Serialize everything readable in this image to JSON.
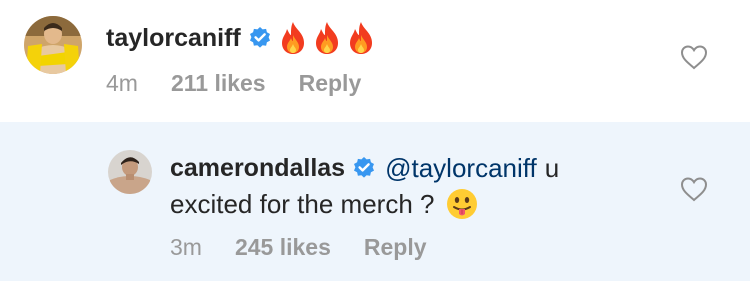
{
  "comments": [
    {
      "username": "taylorcaniff",
      "verified": true,
      "text_emoji": [
        "fire-emoji",
        "fire-emoji",
        "fire-emoji"
      ],
      "time": "4m",
      "likes": "211 likes",
      "reply_label": "Reply",
      "avatar_icon": "avatar-photo"
    },
    {
      "username": "camerondallas",
      "verified": true,
      "mention": "@taylorcaniff",
      "text_line1": "u",
      "text_line2": "excited for the merch ?",
      "text_emoji": "tongue-out-emoji",
      "time": "3m",
      "likes": "245 likes",
      "reply_label": "Reply",
      "avatar_icon": "avatar-photo"
    }
  ],
  "colors": {
    "username": "#262626",
    "mention": "#003569",
    "meta": "#999999",
    "verified_badge": "#3897f0",
    "reply_background": "#eef5fc"
  }
}
